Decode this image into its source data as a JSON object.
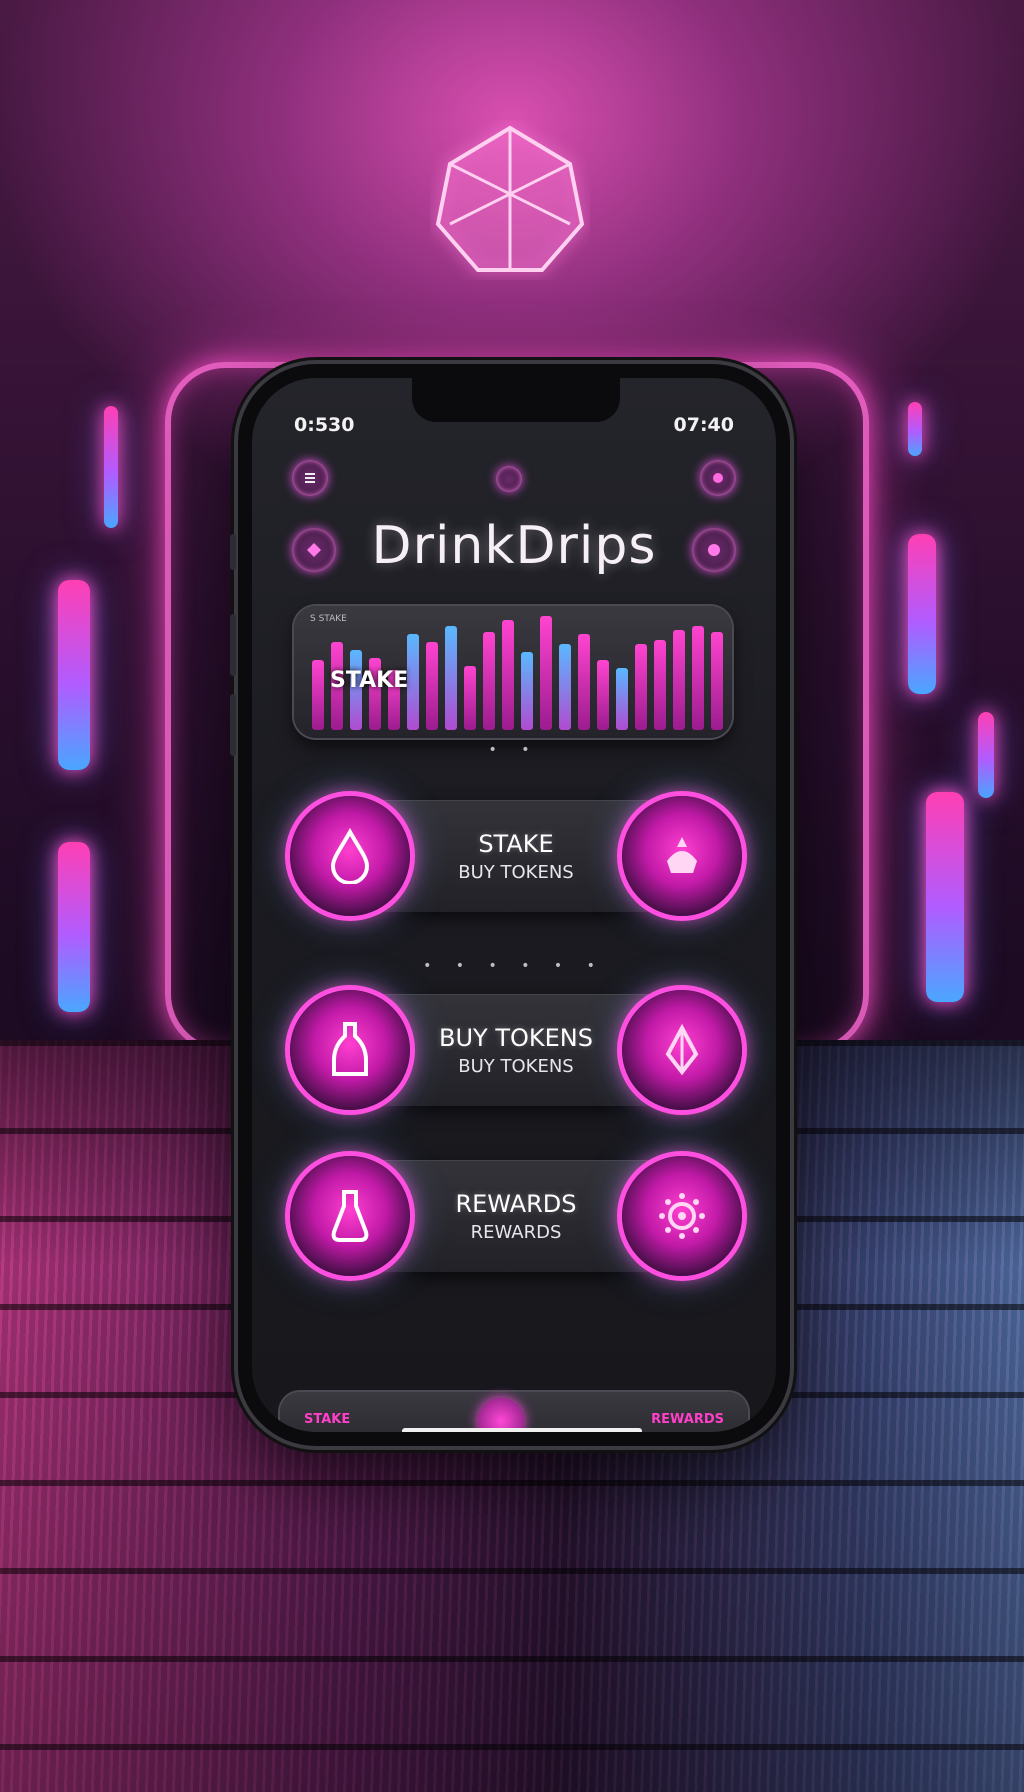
{
  "app": {
    "title": "DrinkDrips",
    "status_time": "0:530",
    "status_right": "07:40"
  },
  "chart_card": {
    "small_caption": "S  STAKE",
    "label": "STAKE"
  },
  "actions": [
    {
      "main_label": "STAKE",
      "sub_label": "BUY TOKENS",
      "left_icon": "drop-icon",
      "right_icon": "drink-icon"
    },
    {
      "main_label": "BUY TOKENS",
      "sub_label": "BUY TOKENS",
      "left_icon": "bottle-icon",
      "right_icon": "token-icon"
    },
    {
      "main_label": "REWARDS",
      "sub_label": "REWARDS",
      "left_icon": "flask-icon",
      "right_icon": "reward-icon"
    }
  ],
  "bottom_nav": {
    "left_label": "STAKE",
    "right_label": "REWARDS"
  },
  "colors": {
    "accent": "#ff3fd0",
    "glow_blue": "#4aa6ff",
    "screen_bg": "#1b1b21"
  }
}
